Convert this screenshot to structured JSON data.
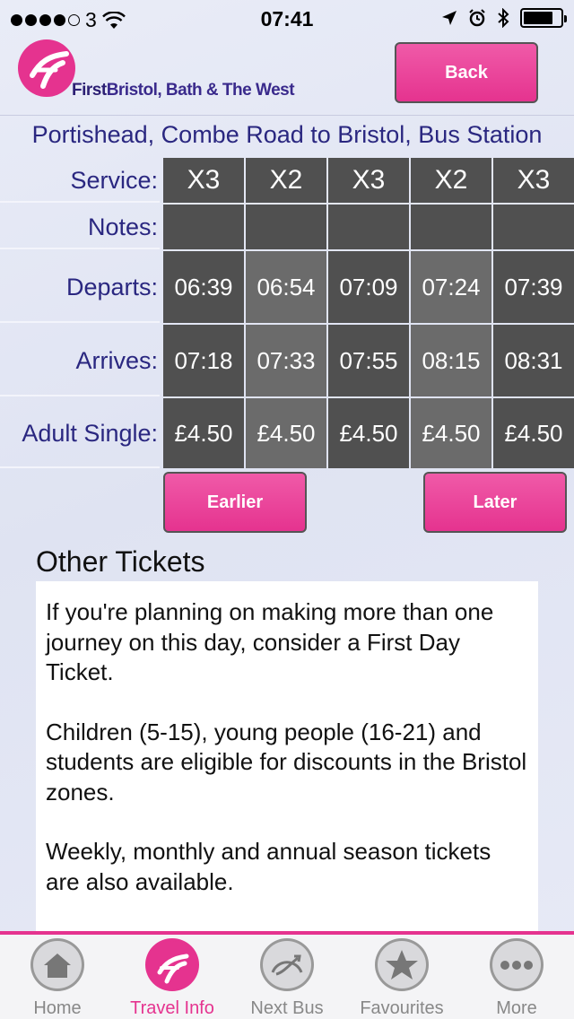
{
  "status_bar": {
    "carrier": "3",
    "time": "07:41"
  },
  "header": {
    "brand_first": "First",
    "brand_rest": "Bristol, Bath & The West",
    "back_label": "Back"
  },
  "route_title": "Portishead, Combe Road to Bristol, Bus Station",
  "timetable": {
    "labels": {
      "service": "Service:",
      "notes": "Notes:",
      "departs": "Departs:",
      "arrives": "Arrives:",
      "fare": "Adult Single:"
    },
    "journeys": [
      {
        "service": "X3",
        "notes": "",
        "departs": "06:39",
        "arrives": "07:18",
        "fare": "£4.50"
      },
      {
        "service": "X2",
        "notes": "",
        "departs": "06:54",
        "arrives": "07:33",
        "fare": "£4.50"
      },
      {
        "service": "X3",
        "notes": "",
        "departs": "07:09",
        "arrives": "07:55",
        "fare": "£4.50"
      },
      {
        "service": "X2",
        "notes": "",
        "departs": "07:24",
        "arrives": "08:15",
        "fare": "£4.50"
      },
      {
        "service": "X3",
        "notes": "",
        "departs": "07:39",
        "arrives": "08:31",
        "fare": "£4.50"
      }
    ],
    "earlier_label": "Earlier",
    "later_label": "Later"
  },
  "other_tickets": {
    "title": "Other Tickets",
    "paragraphs": [
      "If you're planning on making more than one journey on this day, consider a First Day Ticket.",
      "Children (5-15), young people (16-21) and students are eligible for discounts in the Bristol zones.",
      "Weekly, monthly and annual season tickets are also available."
    ]
  },
  "tabs": [
    {
      "label": "Home",
      "icon": "home-icon"
    },
    {
      "label": "Travel Info",
      "icon": "first-logo-icon",
      "active": true
    },
    {
      "label": "Next Bus",
      "icon": "speedometer-icon"
    },
    {
      "label": "Favourites",
      "icon": "star-icon"
    },
    {
      "label": "More",
      "icon": "more-dots-icon"
    }
  ],
  "colors": {
    "accent": "#e5338f",
    "navy": "#2a2780",
    "cell_dark": "#505050",
    "cell_light": "#6b6b6b"
  }
}
